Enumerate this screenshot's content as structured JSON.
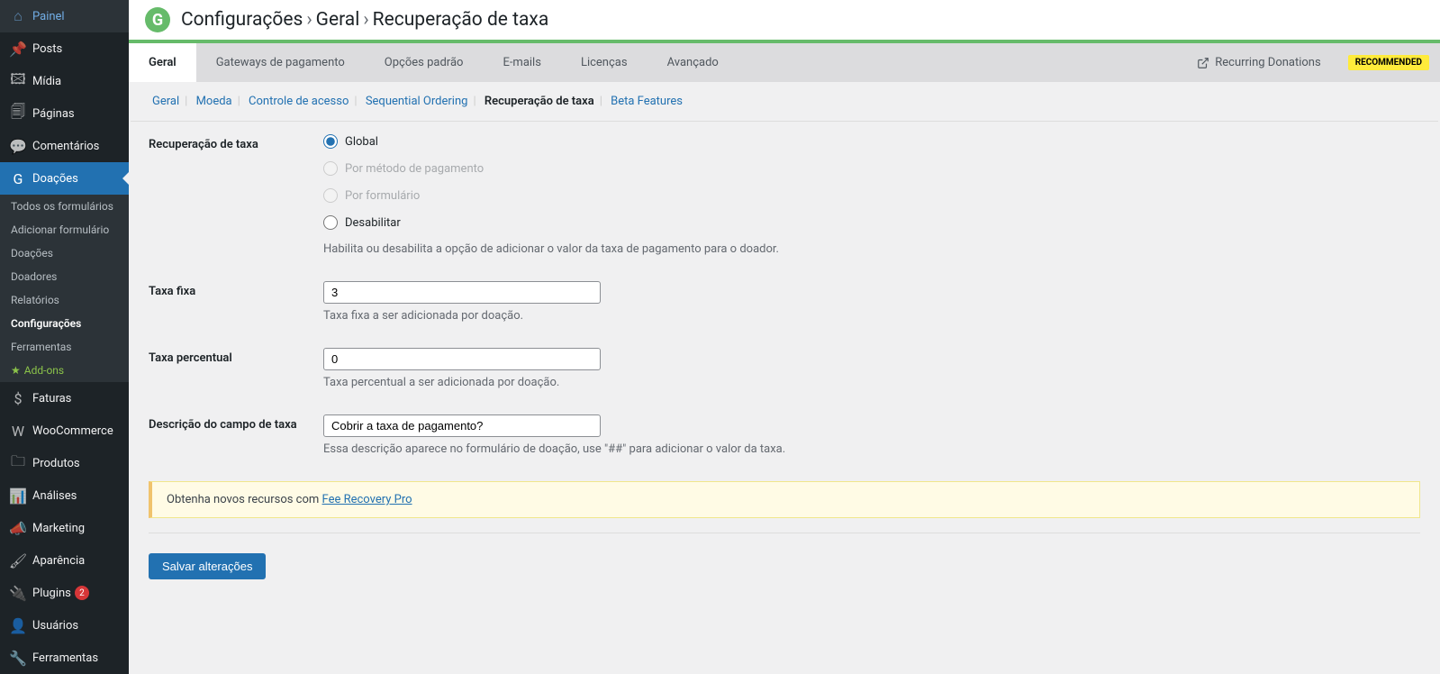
{
  "sidebar": {
    "items": [
      {
        "label": "Painel",
        "icon": "⌂"
      },
      {
        "label": "Posts",
        "icon": "✎"
      },
      {
        "label": "Mídia",
        "icon": "🖾"
      },
      {
        "label": "Páginas",
        "icon": "🗐"
      },
      {
        "label": "Comentários",
        "icon": "💬"
      },
      {
        "label": "Doações",
        "icon": "G"
      },
      {
        "label": "Faturas",
        "icon": "$"
      },
      {
        "label": "WooCommerce",
        "icon": "W"
      },
      {
        "label": "Produtos",
        "icon": "🗀"
      },
      {
        "label": "Análises",
        "icon": "📊"
      },
      {
        "label": "Marketing",
        "icon": "📣"
      },
      {
        "label": "Aparência",
        "icon": "🖌"
      },
      {
        "label": "Plugins",
        "icon": "🔌",
        "badge": "2"
      },
      {
        "label": "Usuários",
        "icon": "👤"
      },
      {
        "label": "Ferramentas",
        "icon": "🔧"
      }
    ],
    "sub": {
      "all_forms": "Todos os formulários",
      "add_form": "Adicionar formulário",
      "donations": "Doações",
      "donors": "Doadores",
      "reports": "Relatórios",
      "settings": "Configurações",
      "tools": "Ferramentas",
      "addons": "Add-ons"
    }
  },
  "breadcrumb": {
    "a": "Configurações",
    "b": "Geral",
    "c": "Recuperação de taxa"
  },
  "tabs": {
    "general": "Geral",
    "gateways": "Gateways de pagamento",
    "defaults": "Opções padrão",
    "emails": "E-mails",
    "licenses": "Licenças",
    "advanced": "Avançado",
    "recurring": "Recurring Donations",
    "recommended": "RECOMMENDED"
  },
  "subtabs": {
    "general": "Geral",
    "currency": "Moeda",
    "access": "Controle de acesso",
    "sequential": "Sequential Ordering",
    "fee": "Recuperação de taxa",
    "beta": "Beta Features"
  },
  "form": {
    "section_label": "Recuperação de taxa",
    "opt_global": "Global",
    "opt_gateway": "Por método de pagamento",
    "opt_form": "Por formulário",
    "opt_disable": "Desabilitar",
    "section_help": "Habilita ou desabilita a opção de adicionar o valor da taxa de pagamento para o doador.",
    "fixed_label": "Taxa fixa",
    "fixed_value": "3",
    "fixed_help": "Taxa fixa a ser adicionada por doação.",
    "pct_label": "Taxa percentual",
    "pct_value": "0",
    "pct_help": "Taxa percentual a ser adicionada por doação.",
    "desc_label": "Descrição do campo de taxa",
    "desc_value": "Cobrir a taxa de pagamento?",
    "desc_help": "Essa descrição aparece no formulário de doação, use \"##\" para adicionar o valor da taxa."
  },
  "notice": {
    "text": "Obtenha novos recursos com ",
    "link": "Fee Recovery Pro"
  },
  "save": "Salvar alterações"
}
